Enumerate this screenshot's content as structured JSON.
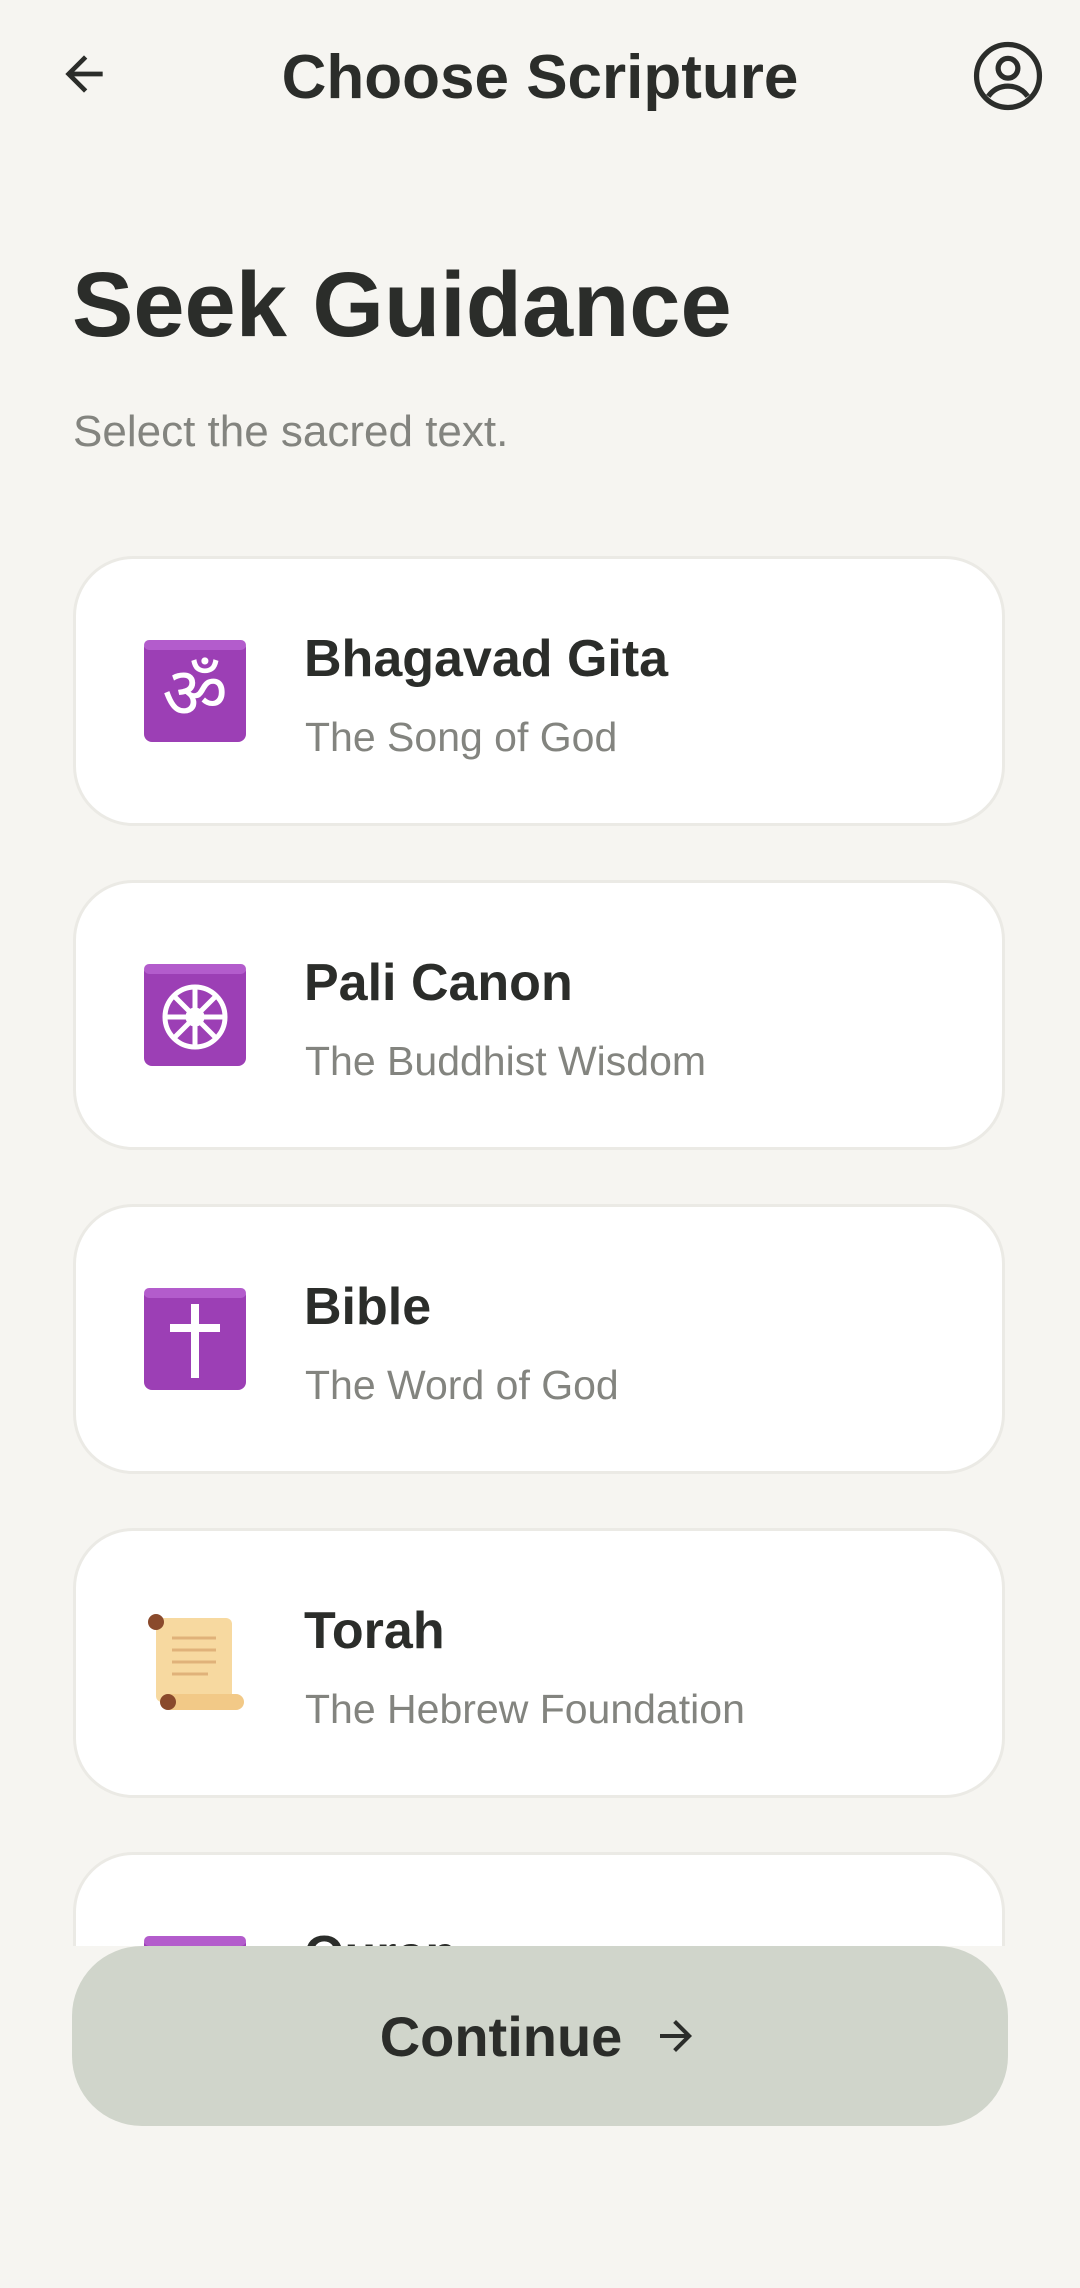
{
  "header": {
    "title": "Choose Scripture",
    "back_icon": "arrow-left-icon",
    "profile_icon": "account-circle-icon"
  },
  "intro": {
    "heading": "Seek Guidance",
    "subheading": "Select the sacred text."
  },
  "scriptures": [
    {
      "title": "Bhagavad Gita",
      "subtitle": "The Song of God",
      "icon": "om-icon",
      "icon_color": "#9c3fb5"
    },
    {
      "title": "Pali Canon",
      "subtitle": "The Buddhist Wisdom",
      "icon": "dharma-wheel-icon",
      "icon_color": "#9c3fb5"
    },
    {
      "title": "Bible",
      "subtitle": "The Word of God",
      "icon": "latin-cross-icon",
      "icon_color": "#9c3fb5"
    },
    {
      "title": "Torah",
      "subtitle": "The Hebrew Foundation",
      "icon": "scroll-icon",
      "icon_color": "#f7d9a0"
    },
    {
      "title": "Quran",
      "subtitle": "",
      "icon": "star-crescent-icon",
      "icon_color": "#9c3fb5"
    }
  ],
  "footer": {
    "continue_label": "Continue",
    "continue_icon": "arrow-right-icon"
  },
  "colors": {
    "background": "#f6f5f1",
    "card": "#ffffff",
    "accent_button": "#d0d5cb",
    "text_primary": "#2b2d2a",
    "text_secondary": "#83847f"
  }
}
